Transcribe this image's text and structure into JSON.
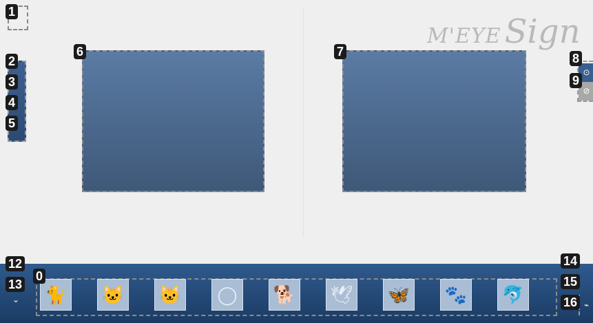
{
  "logo": {
    "small": "M'EYE",
    "big": "Sign"
  },
  "markers": [
    "1",
    "2",
    "3",
    "4",
    "5",
    "6",
    "7",
    "8",
    "9",
    "12",
    "13",
    "0",
    "14",
    "15",
    "16"
  ],
  "thumbnails": [
    {
      "name": "cat-sitting-icon",
      "glyph": "🐈"
    },
    {
      "name": "cat-profile-icon",
      "glyph": "🐱"
    },
    {
      "name": "cat-face-icon",
      "glyph": "🐱"
    },
    {
      "name": "cat-head-outline-icon",
      "glyph": "◯"
    },
    {
      "name": "dog-icon",
      "glyph": "🐕"
    },
    {
      "name": "dove-icon",
      "glyph": "🕊"
    },
    {
      "name": "butterfly-icon",
      "glyph": "🦋"
    },
    {
      "name": "paw-print-icon",
      "glyph": "🐾"
    },
    {
      "name": "dolphin-icon",
      "glyph": "🐬"
    }
  ],
  "right_tools": {
    "top_glyph": "⊙",
    "bottom_glyph": "⊘"
  },
  "nav": {
    "left_glyph": "⌄",
    "right_glyph": "⌁"
  },
  "colors": {
    "frame_top": "#5b7ba4",
    "frame_bottom": "#3e5878",
    "bar": "#2f5a8e"
  }
}
